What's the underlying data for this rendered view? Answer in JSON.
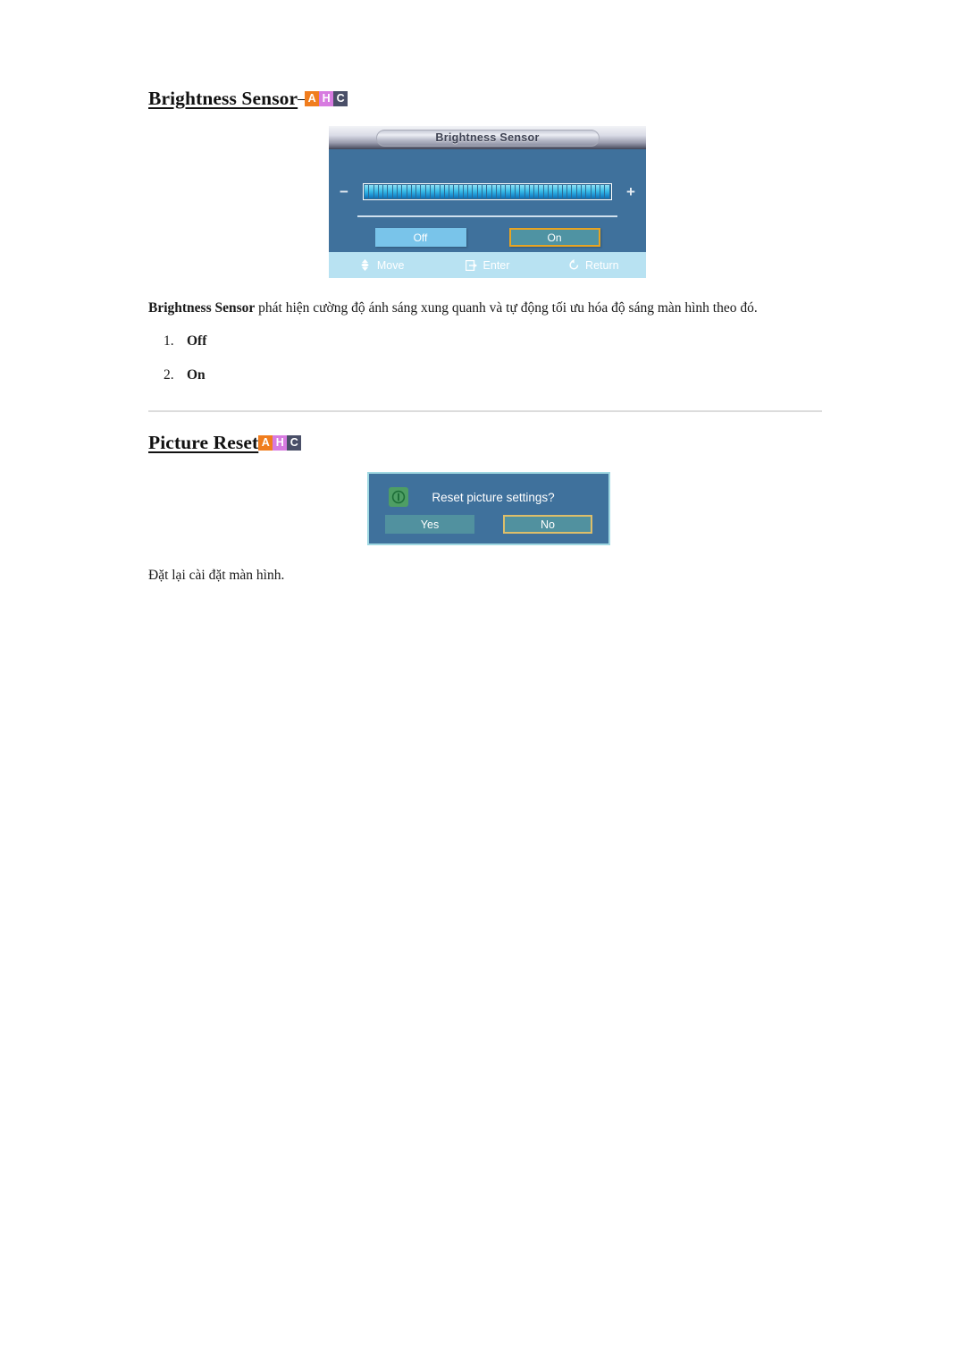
{
  "sections": [
    {
      "heading": "Brightness Sensor",
      "heading_space_before_badges": true,
      "badges": [
        {
          "label": "A",
          "color": "#F07D1E"
        },
        {
          "label": "H",
          "color": "#D77BE0"
        },
        {
          "label": "C",
          "color": "#4A4F68"
        }
      ],
      "osd": {
        "title": "Brightness Sensor",
        "minus": "−",
        "plus": "+",
        "slider_segments": 52,
        "slider_value_percent": 100,
        "buttons": [
          {
            "label": "Off",
            "selected": false
          },
          {
            "label": "On",
            "selected": true
          }
        ],
        "footer": [
          {
            "icon": "move-updown-icon",
            "glyph": "♦",
            "label": "Move"
          },
          {
            "icon": "enter-icon",
            "glyph": "↵",
            "label": "Enter"
          },
          {
            "icon": "return-icon",
            "glyph": "↺",
            "label": "Return"
          }
        ]
      },
      "description_bold": "Brightness Sensor",
      "description_rest": " phát hiện cường độ ánh sáng xung quanh và tự động tối ưu hóa độ sáng màn hình theo đó.",
      "list": [
        {
          "num": "1.",
          "value": "Off"
        },
        {
          "num": "2.",
          "value": "On"
        }
      ]
    },
    {
      "heading": "Picture Reset",
      "heading_space_before_badges": false,
      "badges": [
        {
          "label": "A",
          "color": "#F07D1E"
        },
        {
          "label": "H",
          "color": "#D77BE0"
        },
        {
          "label": "C",
          "color": "#4A4F68"
        }
      ],
      "dialog": {
        "icon": "info-exclamation-icon",
        "message": "Reset picture settings?",
        "buttons": [
          {
            "label": "Yes",
            "selected": false
          },
          {
            "label": "No",
            "selected": true
          }
        ]
      },
      "description": "Đặt lại cài đặt màn hình."
    }
  ],
  "colors": {
    "osd_background": "#3f719c",
    "osd_footer": "#b8e2f2",
    "selected_border": "#e8a422",
    "button_off": "#79c4ea",
    "button_on": "#4f93a3",
    "divider": "#dcdcdc"
  }
}
